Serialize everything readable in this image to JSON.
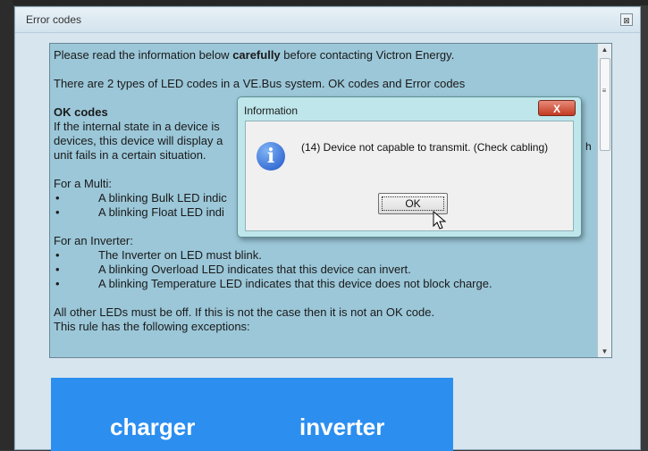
{
  "main_window": {
    "title": "Error codes",
    "close_glyph": "⊠"
  },
  "text": {
    "intro_before": "Please read the information below ",
    "intro_bold": "carefully",
    "intro_after": " before contacting Victron Energy.",
    "types_line": "There are 2 types of LED codes in a VE.Bus system. OK codes and Error codes",
    "ok_heading": "OK codes",
    "ok_line1": "If the internal state in a device is",
    "ok_line2": "devices, this device will display a",
    "ok_line3": "unit fails in a certain situation.",
    "multi_heading": "For a Multi:",
    "multi_bullets": [
      "A blinking Bulk LED indic",
      "A blinking Float LED indi"
    ],
    "inverter_heading": "For an Inverter:",
    "inverter_bullets": [
      "The Inverter on LED must blink.",
      "A blinking Overload LED  indicates that this device can invert.",
      "A blinking Temperature LED indicates that this device does not block charge."
    ],
    "other_line": "All other LEDs must be off. If this is not the case then it is not an OK code.",
    "rule_line": "This rule has the following exceptions:",
    "bullet_glyph": "•",
    "side_fragment": "h"
  },
  "image": {
    "left_label": "charger",
    "right_label": "inverter"
  },
  "dialog": {
    "title": "Information",
    "close_glyph": "X",
    "icon_glyph": "i",
    "message": "(14) Device not capable to transmit. (Check cabling)",
    "ok_label": "OK"
  },
  "colors": {
    "panel_bg": "#9bc7d8",
    "image_blue": "#2c8ff0",
    "dialog_bg": "#bfe6ea",
    "close_red": "#c23b22"
  }
}
